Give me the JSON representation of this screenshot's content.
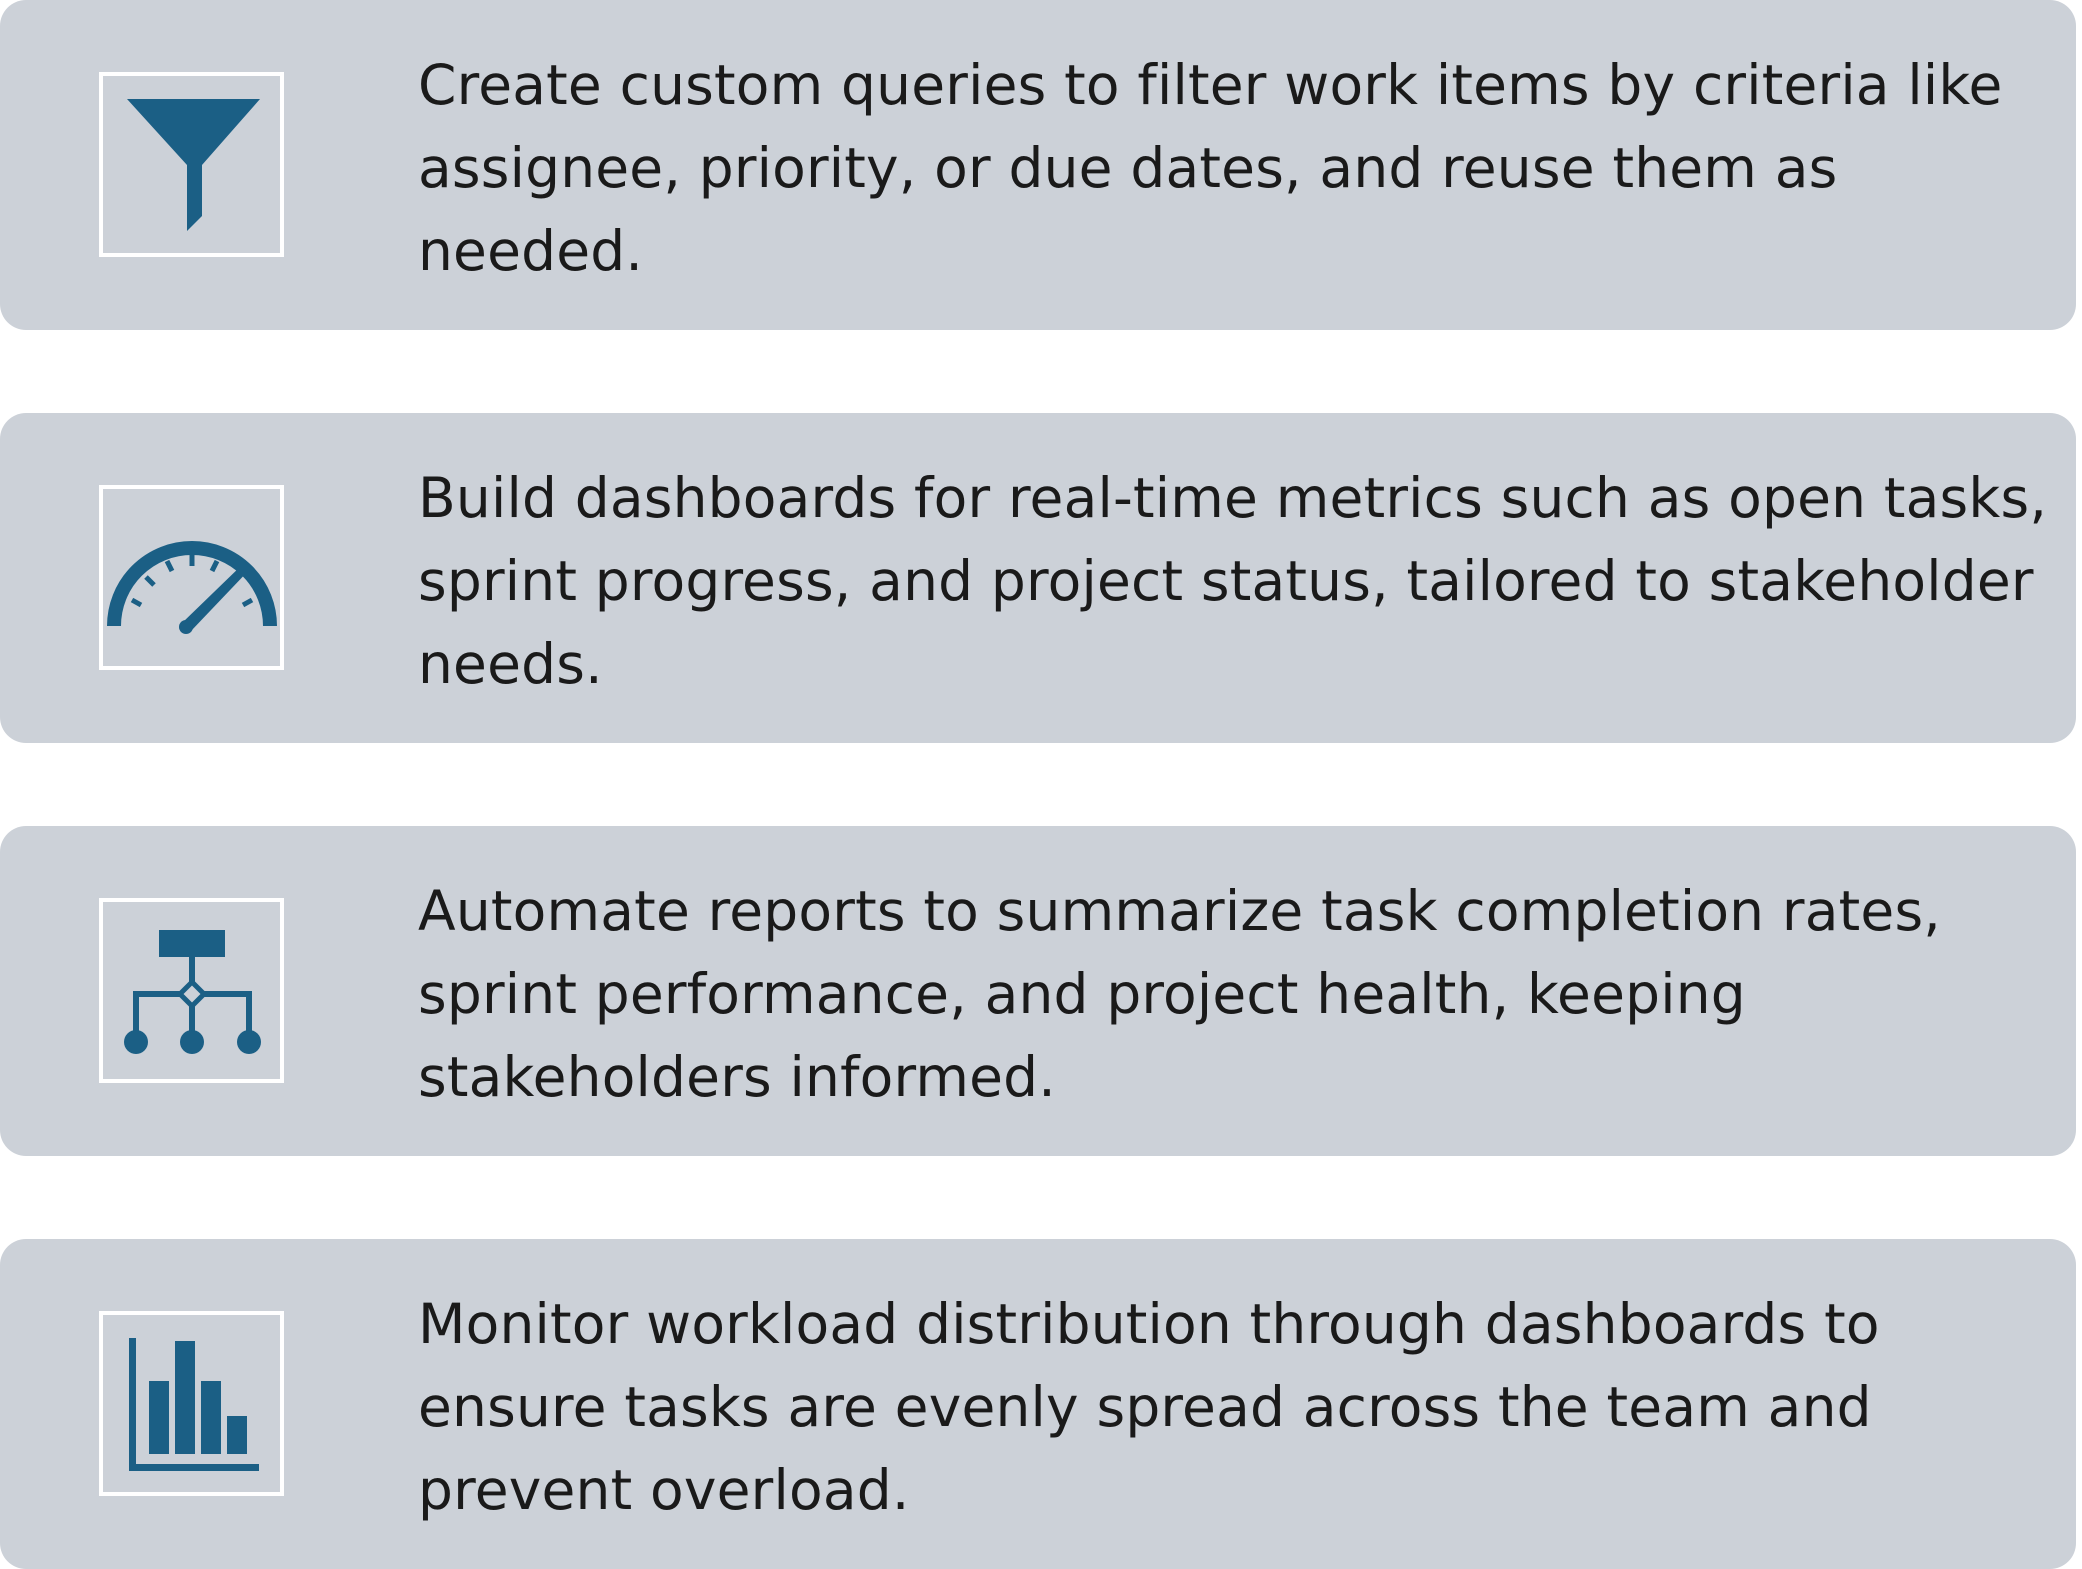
{
  "colors": {
    "card_background": "#ccd1d8",
    "icon_fill": "#1b5f85",
    "icon_frame": "#ffffff",
    "text": "#1a1a1a"
  },
  "cards": [
    {
      "icon": "filter-funnel-icon",
      "text": "Create custom queries to filter work items by criteria like assignee, priority, or due dates, and reuse them as needed."
    },
    {
      "icon": "speedometer-gauge-icon",
      "text": "Build dashboards for real-time metrics such as open tasks, sprint progress, and project status, tailored to stakeholder needs."
    },
    {
      "icon": "hierarchy-flow-icon",
      "text": "Automate reports to summarize task completion rates, sprint performance, and project health, keeping stakeholders informed."
    },
    {
      "icon": "bar-chart-icon",
      "text": "Monitor workload distribution through dashboards to ensure tasks are evenly spread across the team and prevent overload."
    }
  ]
}
